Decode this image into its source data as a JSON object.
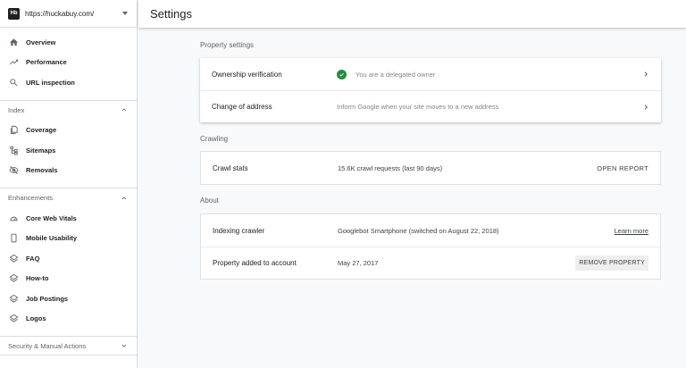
{
  "property": {
    "logo_text": "Hb",
    "url": "https://huckabuy.com/"
  },
  "nav": {
    "top": [
      {
        "label": "Overview",
        "icon": "home-icon"
      },
      {
        "label": "Performance",
        "icon": "trending-up-icon"
      },
      {
        "label": "URL inspection",
        "icon": "search-icon"
      }
    ],
    "index_label": "Index",
    "index": [
      {
        "label": "Coverage",
        "icon": "file-copy-icon"
      },
      {
        "label": "Sitemaps",
        "icon": "sitemap-icon"
      },
      {
        "label": "Removals",
        "icon": "eye-off-icon"
      }
    ],
    "enhancements_label": "Enhancements",
    "enhancements": [
      {
        "label": "Core Web Vitals",
        "icon": "speedometer-icon"
      },
      {
        "label": "Mobile Usability",
        "icon": "phone-icon"
      },
      {
        "label": "FAQ",
        "icon": "layers-icon"
      },
      {
        "label": "How-to",
        "icon": "layers-icon"
      },
      {
        "label": "Job Postings",
        "icon": "layers-icon"
      },
      {
        "label": "Logos",
        "icon": "layers-icon"
      }
    ],
    "security_label": "Security & Manual Actions"
  },
  "header": {
    "title": "Settings"
  },
  "property_settings": {
    "label": "Property settings",
    "ownership": {
      "title": "Ownership verification",
      "value": "You are a delegated owner"
    },
    "address": {
      "title": "Change of address",
      "value": "Inform Google when your site moves to a new address"
    }
  },
  "crawling": {
    "label": "Crawling",
    "crawl_stats": {
      "title": "Crawl stats",
      "value": "15.6K crawl requests (last 90 days)",
      "action": "OPEN REPORT"
    }
  },
  "about": {
    "label": "About",
    "indexing": {
      "title": "Indexing crawler",
      "value": "Googlebot Smartphone (switched on August 22, 2018)",
      "action": "Learn more"
    },
    "added": {
      "title": "Property added to account",
      "value": "May 27, 2017",
      "action": "REMOVE PROPERTY"
    }
  },
  "colors": {
    "accent_green": "#1e8e3e",
    "text": "#202124",
    "muted": "#5f6368"
  }
}
